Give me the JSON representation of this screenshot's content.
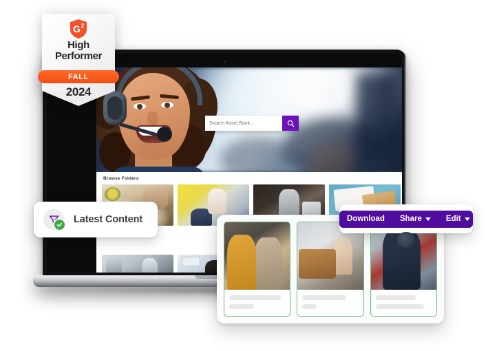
{
  "badge": {
    "name": "g2-high-performer-badge",
    "logo_alt": "G2 logo",
    "title_line1": "High",
    "title_line2": "Performer",
    "season": "FALL",
    "year": "2024",
    "ribbon_color": "#F24E12"
  },
  "laptop": {
    "screen": {
      "search": {
        "placeholder": "Search Asset Bank...",
        "value": "",
        "button_icon": "search-icon",
        "button_color": "#6B12B8"
      },
      "browse": {
        "title": "Browse Folders",
        "thumbnails_row1": [
          {
            "alt": "catering-buffet-table"
          },
          {
            "alt": "classroom-teacher-students"
          },
          {
            "alt": "office-worker-at-desk"
          },
          {
            "alt": "architectural-model-blueprint"
          }
        ],
        "thumbnails_row2": [
          {
            "alt": "laboratory-technicians"
          },
          {
            "alt": "control-room-operator"
          }
        ]
      },
      "hero_alt": "smiling-call-centre-agent-with-headset"
    }
  },
  "filter_pill": {
    "icon": "funnel-filter-icon",
    "status_icon": "check-circle-icon",
    "label": "Latest Content",
    "icon_color": "#6B12B8",
    "check_color": "#3FAA44"
  },
  "cards_panel": {
    "border_color": "#6CBF7A",
    "cards": [
      {
        "alt": "two-women-with-coffee-at-laptop",
        "line1": "",
        "line2": ""
      },
      {
        "alt": "patient-in-hospital-bed-with-nurse",
        "line1": "",
        "line2": ""
      },
      {
        "alt": "firefighter-in-breathing-apparatus",
        "line1": "",
        "line2": ""
      }
    ]
  },
  "toolbar": {
    "background": "#4F0C9E",
    "buttons": [
      {
        "label": "Download",
        "has_caret": false
      },
      {
        "label": "Share",
        "has_caret": true
      },
      {
        "label": "Edit",
        "has_caret": true
      }
    ]
  }
}
